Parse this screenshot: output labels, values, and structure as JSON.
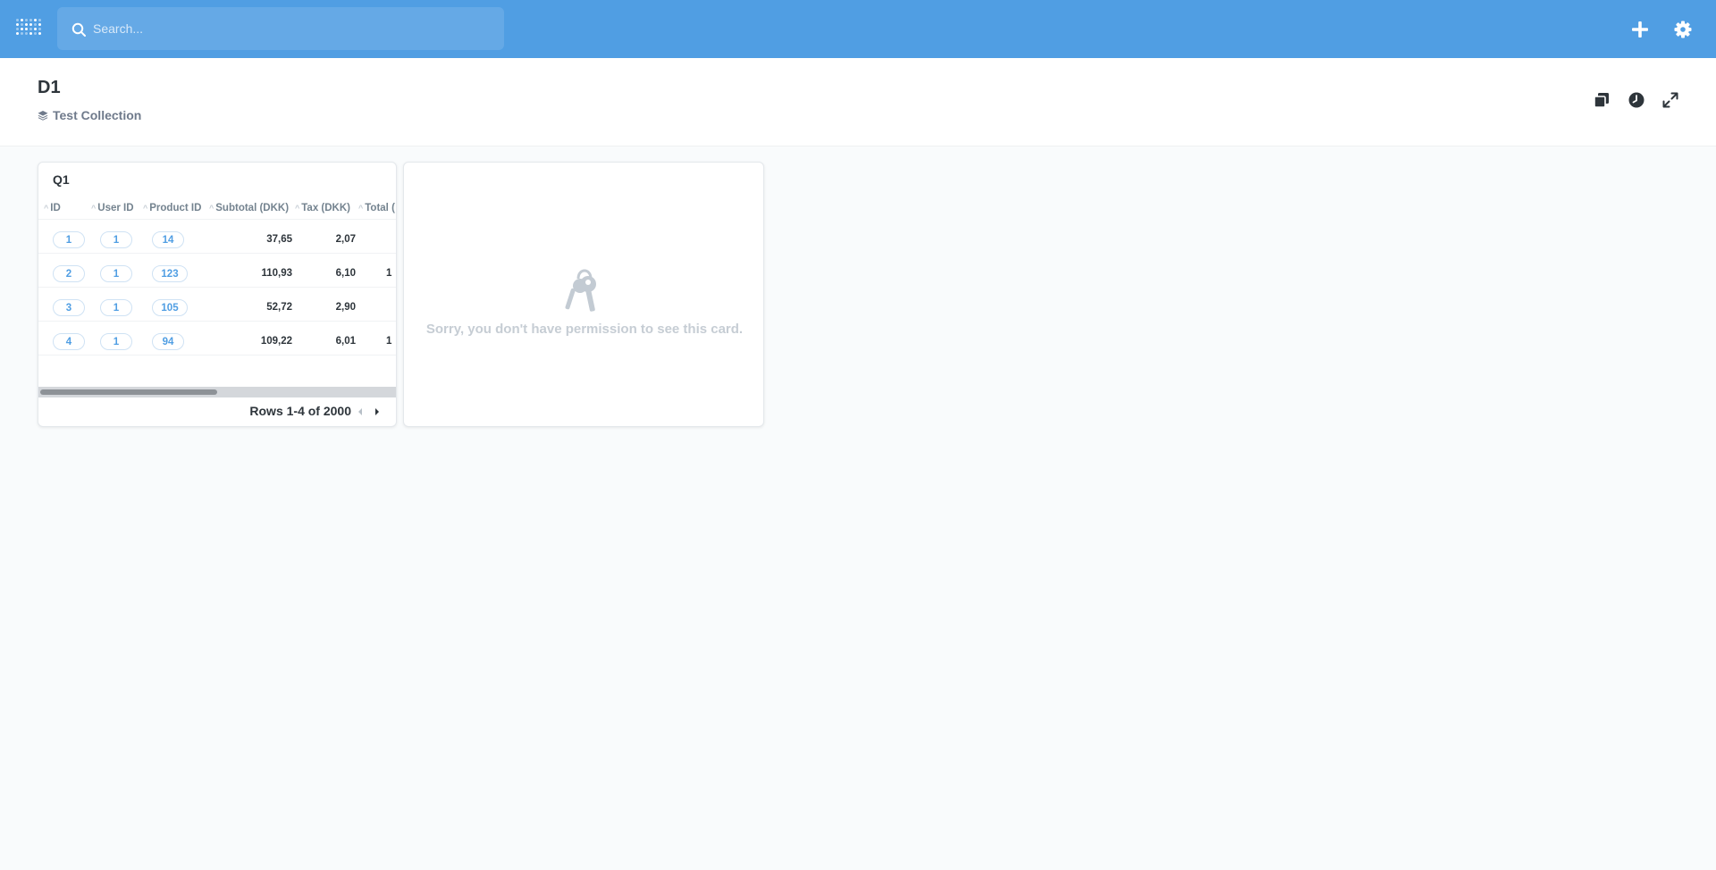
{
  "nav": {
    "search_placeholder": "Search...",
    "logo_icon": "metabase-logo-icon",
    "new_icon": "plus-icon",
    "settings_icon": "gear-icon",
    "brand_color": "#509ee3"
  },
  "dashboard": {
    "title": "D1",
    "collection": "Test Collection",
    "collection_icon": "collection-stack-icon",
    "actions": [
      "duplicate-icon",
      "history-clock-icon",
      "fullscreen-expand-icon"
    ]
  },
  "card1": {
    "title": "Q1",
    "columns": [
      "ID",
      "User ID",
      "Product ID",
      "Subtotal (DKK)",
      "Tax (DKK)",
      "Total ("
    ],
    "rows": [
      [
        "1",
        "1",
        "14",
        "37,65",
        "2,07",
        ""
      ],
      [
        "2",
        "1",
        "123",
        "110,93",
        "6,10",
        "1"
      ],
      [
        "3",
        "1",
        "105",
        "52,72",
        "2,90",
        ""
      ],
      [
        "4",
        "1",
        "94",
        "109,22",
        "6,01",
        "1"
      ]
    ],
    "pagination": "Rows 1-4 of 2000"
  },
  "card2": {
    "icon": "keys-icon",
    "message": "Sorry, you don't have permission to see this card."
  }
}
